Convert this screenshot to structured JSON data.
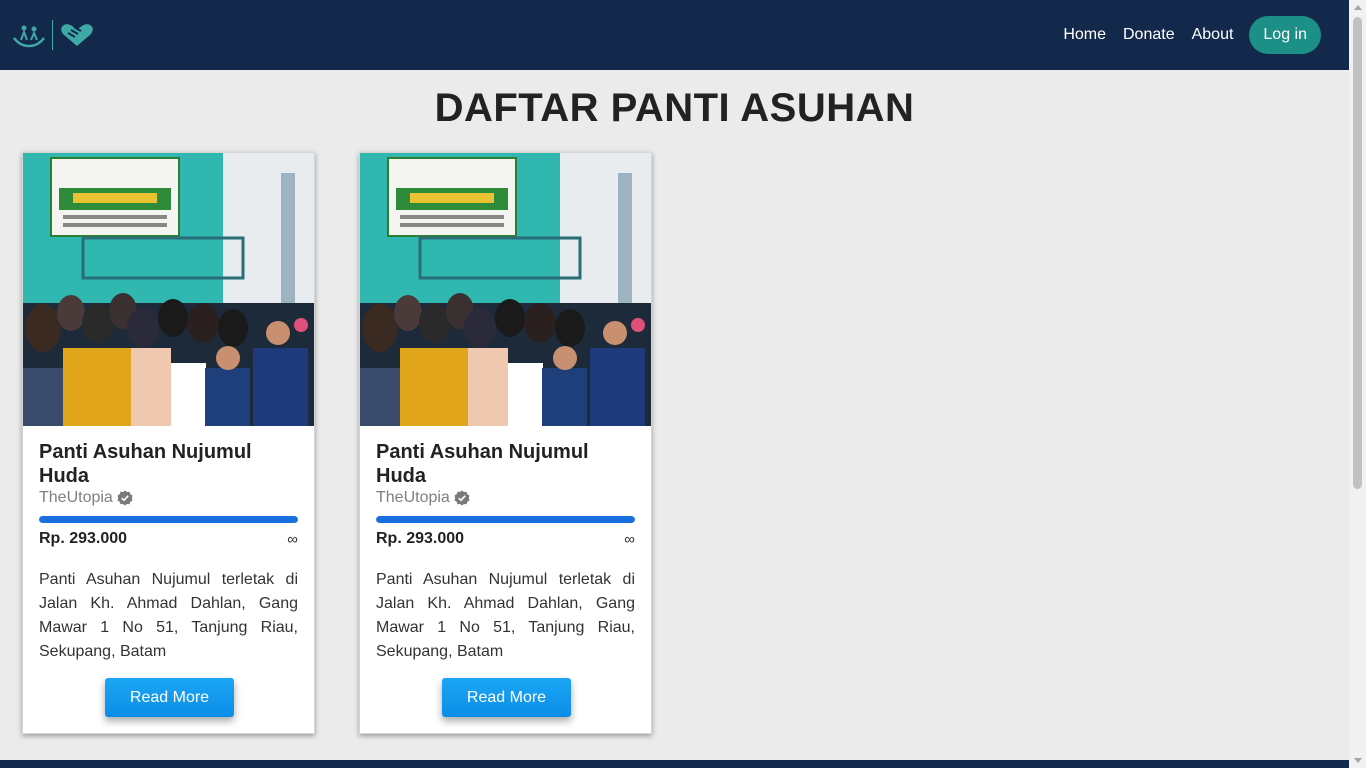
{
  "nav": {
    "links": [
      "Home",
      "Donate",
      "About"
    ],
    "login_label": "Log in"
  },
  "page_title": "DAFTAR PANTI ASUHAN",
  "cards": [
    {
      "title": "Panti Asuhan Nujumul Huda",
      "org": "TheUtopia",
      "progress": 1.0,
      "amount": "Rp. 293.000",
      "target": "∞",
      "description": "Panti Asuhan Nujumul terletak di Jalan Kh. Ahmad Dahlan, Gang Mawar 1 No 51, Tanjung Riau, Sekupang, Batam",
      "button_label": "Read More"
    },
    {
      "title": "Panti Asuhan Nujumul Huda",
      "org": "TheUtopia",
      "progress": 1.0,
      "amount": "Rp. 293.000",
      "target": "∞",
      "description": "Panti Asuhan Nujumul terletak di Jalan Kh. Ahmad Dahlan, Gang Mawar 1 No 51, Tanjung Riau, Sekupang, Batam",
      "button_label": "Read More"
    }
  ],
  "colors": {
    "navbar_bg": "#13294b",
    "login_bg": "#1c8f86",
    "progress_fill": "#1a6fde",
    "button_bg": "#0b8de6"
  },
  "icons": {
    "logo": "hands-charity-logo",
    "verified": "verified-check-icon"
  }
}
